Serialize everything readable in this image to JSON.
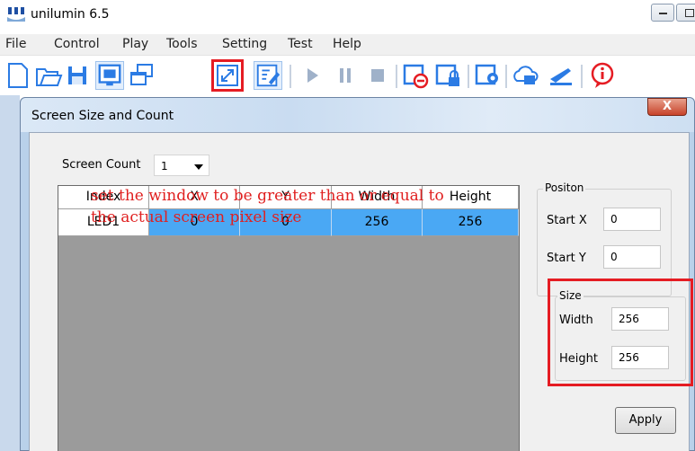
{
  "app": {
    "title": "unilumin 6.5"
  },
  "menu": [
    "File",
    "Control",
    "Play",
    "Tools",
    "Setting",
    "Test",
    "Help"
  ],
  "toolbar": {
    "icons": [
      "new-file-icon",
      "open-folder-icon",
      "save-icon",
      "screen-icon",
      "multi-window-icon",
      "screen-size-icon",
      "edit-icon",
      "play-icon",
      "pause-icon",
      "stop-icon",
      "remove-screen-icon",
      "lock-screen-icon",
      "screen-settings-icon",
      "cloud-icon",
      "brightness-icon",
      "info-icon"
    ],
    "highlight_color": "#e51c23"
  },
  "dialog": {
    "title": "Screen Size and Count",
    "close_label": "X",
    "screen_count": {
      "label": "Screen Count",
      "value": "1"
    },
    "table": {
      "columns": [
        "Index",
        "X",
        "Y",
        "Width",
        "Height"
      ],
      "rows": [
        {
          "index": "LED1",
          "x": "0",
          "y": "0",
          "width": "256",
          "height": "256"
        }
      ],
      "selection_color": "#4aa8f4"
    },
    "annotation": "set the window to be greater than or equal to the actual screen pixel size",
    "position": {
      "title": "Positon",
      "start_x_label": "Start X",
      "start_x": "0",
      "start_y_label": "Start Y",
      "start_y": "0"
    },
    "size": {
      "title": "Size",
      "width_label": "Width",
      "width": "256",
      "height_label": "Height",
      "height": "256"
    },
    "apply_label": "Apply"
  }
}
